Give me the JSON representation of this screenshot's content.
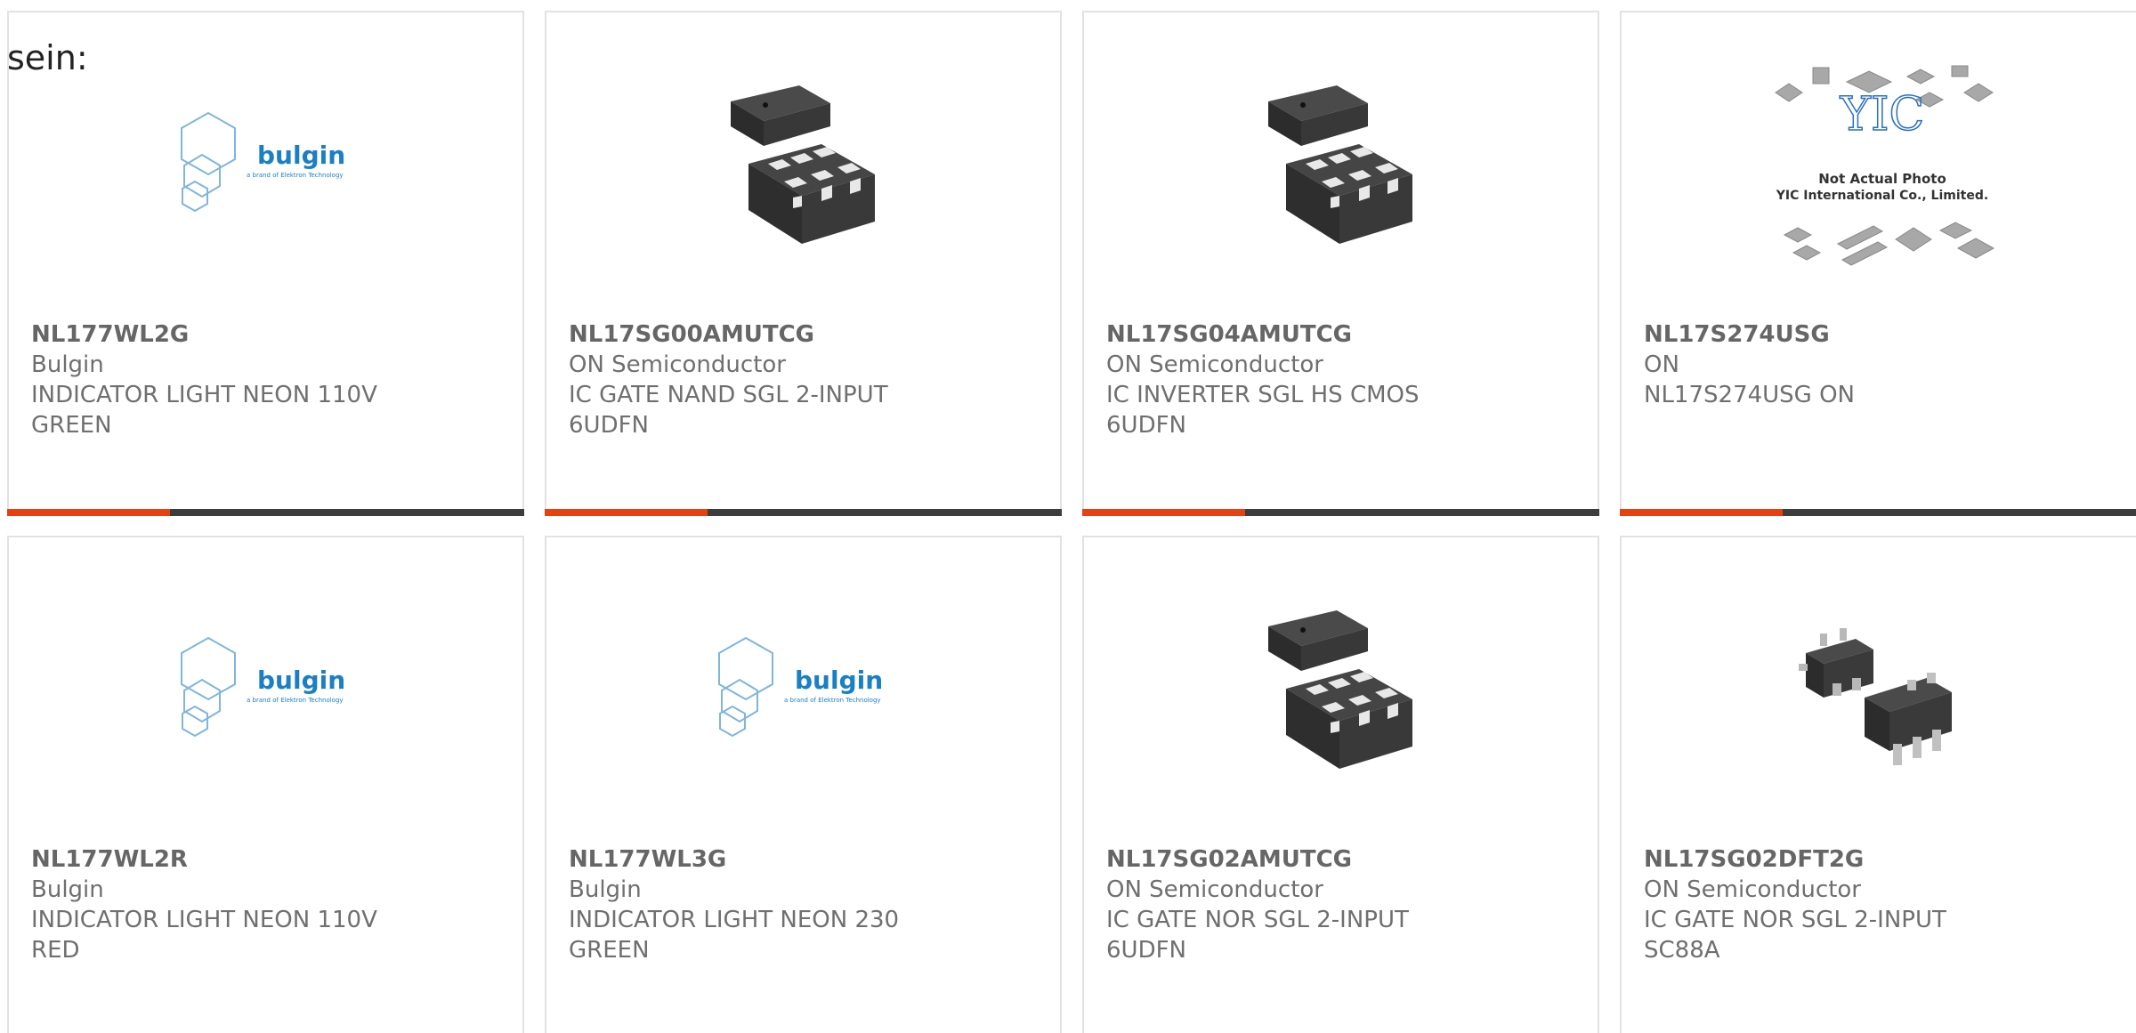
{
  "intro_text": "sein:",
  "colors": {
    "accent": "#e8400f",
    "bar": "#3d3d3d",
    "border": "#e2e2e2",
    "bulgin_blue": "#1a7fc4"
  },
  "cards": [
    {
      "part_number": "NL177WL2G",
      "manufacturer": "Bulgin",
      "description_line1": "INDICATOR LIGHT NEON 110V",
      "description_line2": "GREEN",
      "image": "bulgin-logo",
      "logo_text": "bulgin",
      "logo_subtext": "a brand of Elektron Technology"
    },
    {
      "part_number": "NL17SG00AMUTCG",
      "manufacturer": "ON Semiconductor",
      "description_line1": "IC GATE NAND SGL 2-INPUT",
      "description_line2": "6UDFN",
      "image": "udfn-package-chip"
    },
    {
      "part_number": "NL17SG04AMUTCG",
      "manufacturer": "ON Semiconductor",
      "description_line1": "IC INVERTER SGL HS CMOS",
      "description_line2": "6UDFN",
      "image": "udfn-package-chip"
    },
    {
      "part_number": "NL17S274USG",
      "manufacturer": "ON",
      "description_line1": "NL17S274USG ON",
      "description_line2": "",
      "image": "yic-placeholder",
      "placeholder_line1": "Not Actual Photo",
      "placeholder_line2": "YIC International Co., Limited."
    },
    {
      "part_number": "NL177WL2R",
      "manufacturer": "Bulgin",
      "description_line1": "INDICATOR LIGHT NEON 110V",
      "description_line2": "RED",
      "image": "bulgin-logo",
      "logo_text": "bulgin",
      "logo_subtext": "a brand of Elektron Technology"
    },
    {
      "part_number": "NL177WL3G",
      "manufacturer": "Bulgin",
      "description_line1": "INDICATOR LIGHT NEON 230",
      "description_line2": "GREEN",
      "image": "bulgin-logo",
      "logo_text": "bulgin",
      "logo_subtext": "a brand of Elektron Technology"
    },
    {
      "part_number": "NL17SG02AMUTCG",
      "manufacturer": "ON Semiconductor",
      "description_line1": "IC GATE NOR SGL 2-INPUT",
      "description_line2": "6UDFN",
      "image": "udfn-package-chip"
    },
    {
      "part_number": "NL17SG02DFT2G",
      "manufacturer": "ON Semiconductor",
      "description_line1": "IC GATE NOR SGL 2-INPUT",
      "description_line2": "SC88A",
      "image": "sc88a-package-chip"
    }
  ]
}
